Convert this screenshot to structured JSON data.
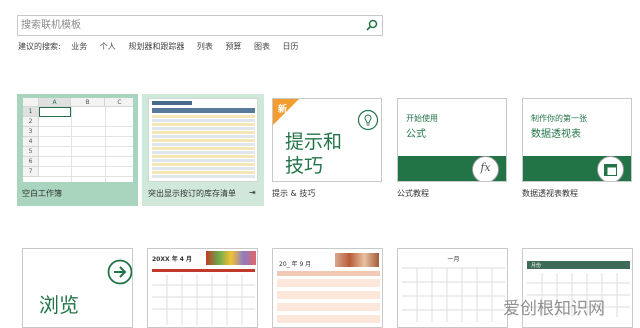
{
  "search": {
    "placeholder": "搜索联机模板"
  },
  "suggested": {
    "label": "建议的搜索:",
    "items": [
      "业务",
      "个人",
      "规划器和跟踪器",
      "列表",
      "预算",
      "图表",
      "日历"
    ]
  },
  "templates": [
    {
      "caption": "空白工作簿",
      "columns": [
        "A",
        "B",
        "C"
      ],
      "rows": [
        "1",
        "2",
        "3",
        "4",
        "5",
        "6",
        "7"
      ]
    },
    {
      "caption": "突出显示按订的库存清单",
      "pin": "⇥"
    },
    {
      "caption": "提示 & 技巧",
      "badge": "新",
      "title_line1": "提示和",
      "title_line2": "技巧"
    },
    {
      "caption": "公式教程",
      "line1": "开始使用",
      "line2": "公式",
      "icon_text": "fx"
    },
    {
      "caption": "数据透视表教程",
      "line1": "制作你的第一张",
      "line2": "数据透视表"
    }
  ],
  "row2": {
    "browse": "浏览",
    "cal1_title": "20XX 年 4 月",
    "cal2_title": "20_ 年 9 月",
    "cal3_title": "一月",
    "cal4_title": "月份"
  },
  "watermark": "爱创根知识网",
  "colors": {
    "accent": "#227447",
    "selected": "#a9d4bd"
  }
}
